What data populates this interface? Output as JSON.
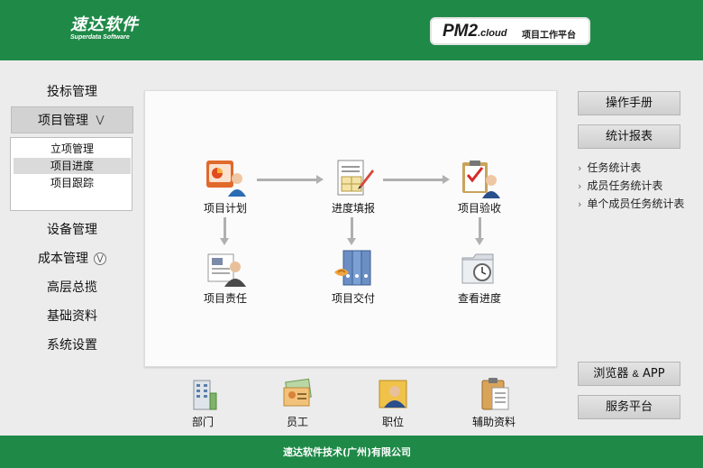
{
  "header": {
    "logo_cn": "速达软件",
    "logo_en": "Superdata Software",
    "product": "PM2",
    "product_suffix": ".cloud",
    "product_sub": "项目工作平台"
  },
  "sidebar": {
    "items": [
      {
        "label": "投标管理"
      },
      {
        "label": "项目管理",
        "chevron": "»"
      },
      {
        "label": "设备管理"
      },
      {
        "label": "成本管理",
        "chevron": "»"
      },
      {
        "label": "高层总揽"
      },
      {
        "label": "基础资料"
      },
      {
        "label": "系统设置"
      }
    ],
    "submenu": [
      {
        "label": "立项管理"
      },
      {
        "label": "项目进度"
      },
      {
        "label": "项目跟踪"
      }
    ]
  },
  "flow": {
    "nodes": [
      {
        "label": "项目计划",
        "icon": "presentation-icon"
      },
      {
        "label": "进度填报",
        "icon": "form-pen-icon"
      },
      {
        "label": "项目验收",
        "icon": "clipboard-check-icon"
      },
      {
        "label": "项目责任",
        "icon": "document-person-icon"
      },
      {
        "label": "项目交付",
        "icon": "binders-icon"
      },
      {
        "label": "查看进度",
        "icon": "folder-clock-icon"
      }
    ]
  },
  "bottom": {
    "items": [
      {
        "label": "部门",
        "icon": "building-icon"
      },
      {
        "label": "员工",
        "icon": "employee-cards-icon"
      },
      {
        "label": "职位",
        "icon": "position-person-icon"
      },
      {
        "label": "辅助资料",
        "icon": "clipboard-doc-icon"
      }
    ]
  },
  "right": {
    "manual": "操作手册",
    "report": "统计报表",
    "links": [
      "任务统计表",
      "成员任务统计表",
      "单个成员任务统计表"
    ],
    "browser_a": "浏览器",
    "browser_amp": "&",
    "browser_b": "APP",
    "service": "服务平台"
  },
  "footer": {
    "text": "速达软件技术(广州)有限公司"
  },
  "colors": {
    "brand_green": "#1f8a48",
    "panel_bg": "#fbfbfb",
    "page_bg": "#ececec"
  }
}
